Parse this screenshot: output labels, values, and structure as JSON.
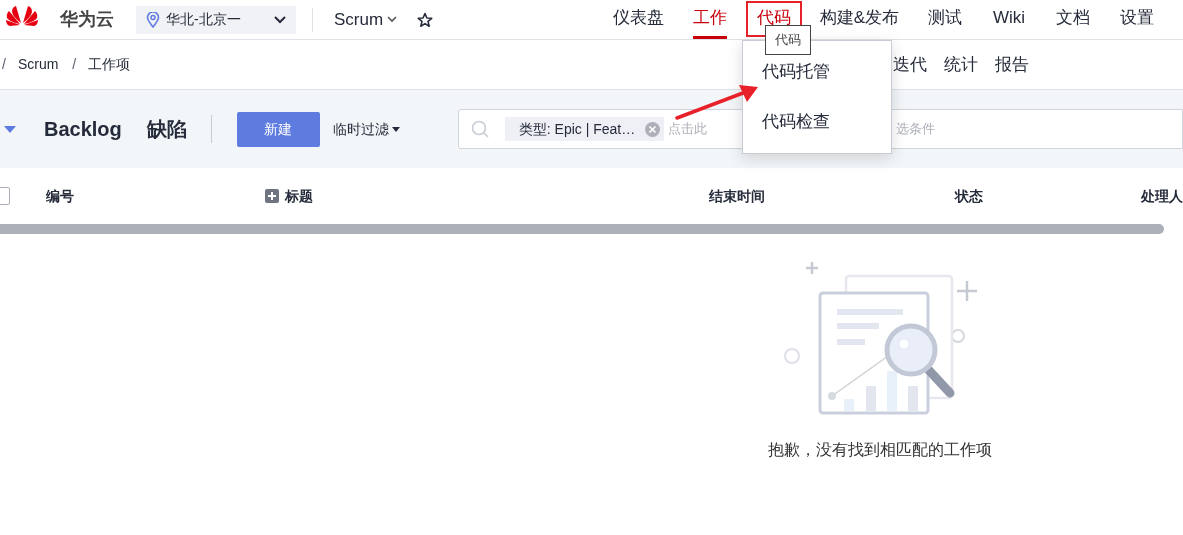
{
  "header": {
    "brand": "华为云",
    "region": "华北-北京一",
    "project": "Scrum",
    "nav": [
      {
        "label": "仪表盘",
        "selected": false
      },
      {
        "label": "工作",
        "selected": true
      },
      {
        "label": "代码",
        "selected": false,
        "highlighted": true
      },
      {
        "label": "构建&发布",
        "selected": false
      },
      {
        "label": "测试",
        "selected": false
      },
      {
        "label": "Wiki",
        "selected": false
      },
      {
        "label": "文档",
        "selected": false
      },
      {
        "label": "设置",
        "selected": false
      }
    ]
  },
  "breadcrumb": [
    {
      "separator": "/",
      "label": "Scrum"
    },
    {
      "separator": "/",
      "label": "工作项"
    }
  ],
  "subnav": [
    "迭代",
    "统计",
    "报告"
  ],
  "toolbar": {
    "tabs": [
      {
        "label": "Backlog",
        "selected": false
      },
      {
        "label": "缺陷",
        "selected": false
      }
    ],
    "new_button": "新建",
    "filter": "临时过滤",
    "search": {
      "tag": "类型: Epic | Feat…",
      "placeholder": "点击此",
      "placeholder_tail": "选条件"
    }
  },
  "table": {
    "select_all_checked": false,
    "columns": [
      "编号",
      "标题",
      "结束时间",
      "状态",
      "处理人"
    ]
  },
  "empty_state": {
    "message": "抱歉，没有找到相匹配的工作项"
  },
  "tooltip": "代码",
  "dropdown": {
    "items": [
      "代码托管",
      "代码检查"
    ]
  }
}
